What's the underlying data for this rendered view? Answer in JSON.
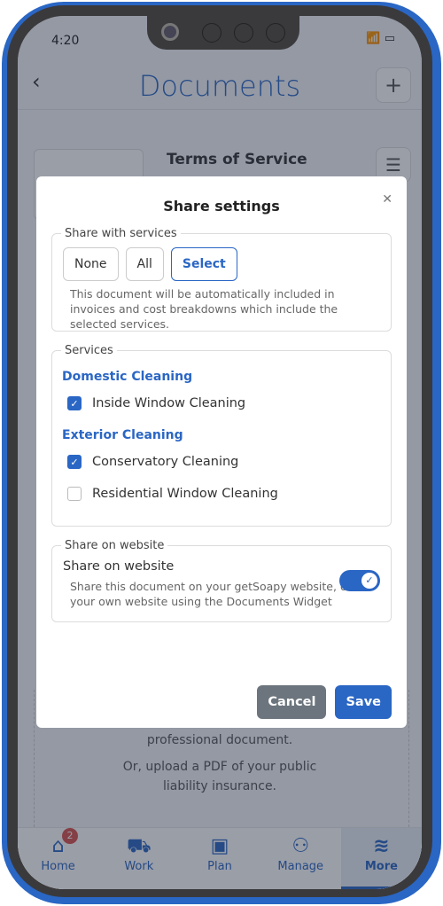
{
  "status": {
    "time": "4:20"
  },
  "header": {
    "title": "Documents"
  },
  "document": {
    "title": "Terms of Service"
  },
  "background_text": {
    "line1": "professional document.",
    "line2": "Or, upload a PDF of your public",
    "line3": "liability insurance."
  },
  "tabbar": {
    "items": [
      {
        "label": "Home",
        "icon": "home-icon",
        "badge": "2"
      },
      {
        "label": "Work",
        "icon": "truck-icon"
      },
      {
        "label": "Plan",
        "icon": "calendar-check-icon"
      },
      {
        "label": "Manage",
        "icon": "users-icon"
      },
      {
        "label": "More",
        "icon": "layers-icon",
        "active": true
      }
    ]
  },
  "modal": {
    "title": "Share settings",
    "share_services": {
      "legend": "Share with services",
      "options": [
        "None",
        "All",
        "Select"
      ],
      "selected": "Select",
      "hint": "This document will be automatically included in invoices and cost breakdowns which include the selected services."
    },
    "services": {
      "legend": "Services",
      "groups": [
        {
          "name": "Domestic Cleaning",
          "items": [
            {
              "label": "Inside Window Cleaning",
              "checked": true
            }
          ]
        },
        {
          "name": "Exterior Cleaning",
          "items": [
            {
              "label": "Conservatory Cleaning",
              "checked": true
            },
            {
              "label": "Residential Window Cleaning",
              "checked": false
            }
          ]
        }
      ]
    },
    "website": {
      "legend": "Share on website",
      "label": "Share on website",
      "enabled": true,
      "hint": "Share this document on your getSoapy website, or on your own website using the Documents Widget"
    },
    "cancel": "Cancel",
    "save": "Save"
  },
  "colors": {
    "accent": "#2a66c4",
    "cancel": "#6c757d",
    "badge": "#d9534f"
  }
}
